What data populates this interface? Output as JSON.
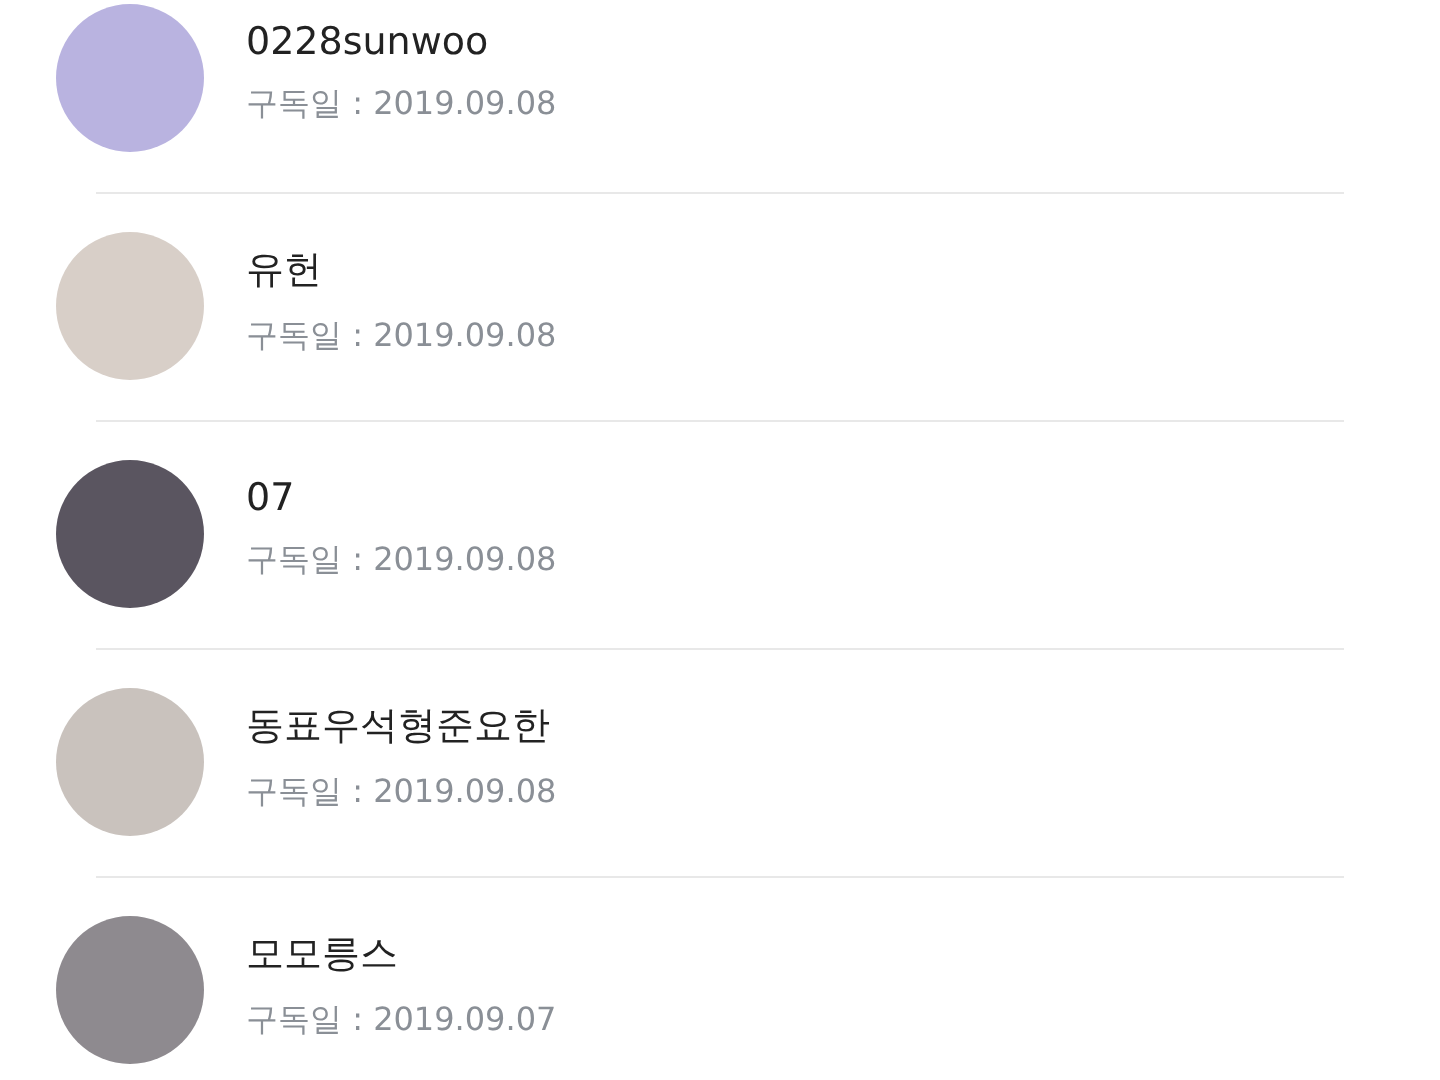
{
  "subscribers": [
    {
      "name": "0228sunwoo",
      "subscribed": "구독일 : 2019.09.08"
    },
    {
      "name": "유헌",
      "subscribed": "구독일 : 2019.09.08"
    },
    {
      "name": "07",
      "subscribed": "구독일 : 2019.09.08"
    },
    {
      "name": "동표우석형준요한",
      "subscribed": "구독일 : 2019.09.08"
    },
    {
      "name": "모모릉스",
      "subscribed": "구독일 : 2019.09.07"
    }
  ]
}
